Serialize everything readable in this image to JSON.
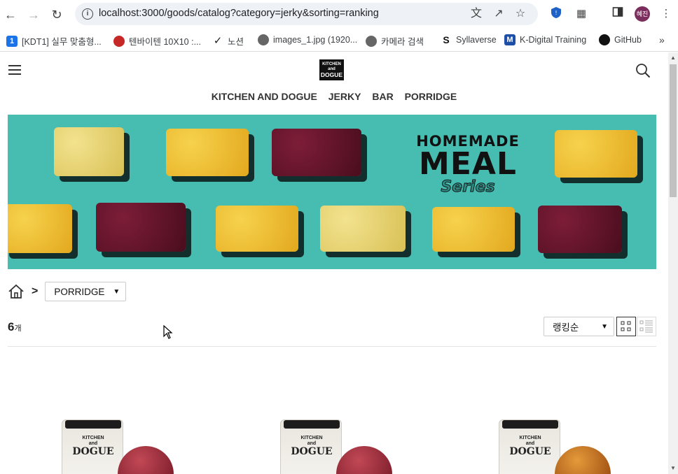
{
  "browser": {
    "url": "localhost:3000/goods/catalog?category=jerky&sorting=ranking",
    "profile_initials": "혜진"
  },
  "bookmarks": [
    {
      "label": "[KDT1] 실무 맞춤형...",
      "icon": "kdt-icon"
    },
    {
      "label": "텐바이텐 10X10 :...",
      "icon": "tenbyten-icon"
    },
    {
      "label": "노션",
      "icon": "notion-check-icon"
    },
    {
      "label": "images_1.jpg (1920...",
      "icon": "globe-icon"
    },
    {
      "label": "카메라 검색",
      "icon": "globe-icon"
    },
    {
      "label": "Syllaverse",
      "icon": "s-icon"
    },
    {
      "label": "K-Digital Training",
      "icon": "m-icon"
    },
    {
      "label": "GitHub",
      "icon": "github-icon"
    }
  ],
  "header": {
    "logo_line1": "KITCHEN",
    "logo_line2": "and",
    "logo_line3": "DOGUE"
  },
  "category_nav": [
    "KITCHEN AND DOGUE",
    "JERKY",
    "BAR",
    "PORRIDGE"
  ],
  "banner": {
    "line1": "HOMEMADE",
    "line2": "MEAL",
    "line3": "Series"
  },
  "breadcrumb": {
    "separator": ">",
    "category_select": "PORRIDGE"
  },
  "listing": {
    "count": "6",
    "count_unit": "개",
    "sort_select": "랭킹순"
  },
  "products": [
    {
      "label_top": "KITCHEN",
      "label_mid": "and",
      "label_brand": "DOGUE"
    },
    {
      "label_top": "KITCHEN",
      "label_mid": "and",
      "label_brand": "DOGUE"
    },
    {
      "label_top": "KITCHEN",
      "label_mid": "and",
      "label_brand": "DOGUE"
    }
  ],
  "colors": {
    "banner_bg": "#47bdb2",
    "text": "#222222"
  }
}
